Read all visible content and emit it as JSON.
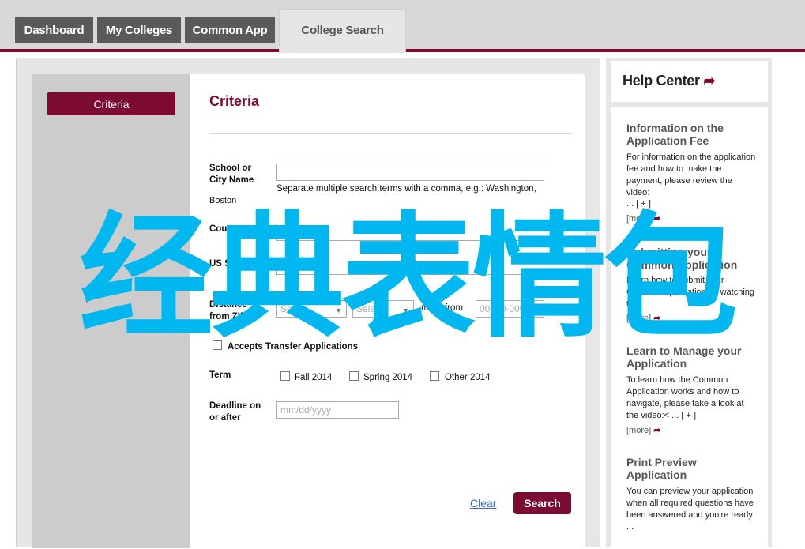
{
  "nav": {
    "tabs": [
      {
        "label": "Dashboard"
      },
      {
        "label": "My Colleges"
      },
      {
        "label": "Common App"
      },
      {
        "label": "College Search",
        "active": true
      }
    ]
  },
  "sidebar": {
    "criteria_label": "Criteria"
  },
  "form": {
    "title": "Criteria",
    "school_label": "School or City Name",
    "school_value": "",
    "school_help": "Separate multiple search terms with a comma, e.g.: Washington,",
    "school_example": "Boston",
    "country_label": "Country",
    "country_placeholder": "Select",
    "us_state_label": "US State",
    "distance_label": "Distance from ZIP",
    "distance_select_1": "Select",
    "distance_select_2": "Select",
    "miles_from_label": "miles from",
    "zip_placeholder": "00000-0000",
    "transfer_label": "Accepts Transfer Applications",
    "term_label": "Term",
    "term_options": [
      "Fall 2014",
      "Spring 2014",
      "Other 2014"
    ],
    "deadline_label": "Deadline on or after",
    "deadline_placeholder": "mm/dd/yyyy",
    "clear_label": "Clear",
    "search_label": "Search"
  },
  "help_center": {
    "title": "Help Center",
    "items": [
      {
        "title": "Information on the Application Fee",
        "text": "For information on the application fee and how to make the payment, please review the video:",
        "expand": "... [ + ]",
        "more": "[more]"
      },
      {
        "title": "Submitting your Common Application",
        "text": "Learn how to submit your Common Application by watching the",
        "more": "[more]"
      },
      {
        "title": "Learn to Manage your Application",
        "text": "To learn how the Common Application works and how to navigate, please take a look at the video:< ... [ + ]",
        "more": "[more]"
      },
      {
        "title": "Print Preview Application",
        "text": "You can preview your application when all required questions have been answered and you're ready ..."
      }
    ]
  },
  "overlay": {
    "text": "经典表情包"
  },
  "colors": {
    "brand": "#7d0a32",
    "link": "#3366cc",
    "overlay": "#00b7f0"
  }
}
